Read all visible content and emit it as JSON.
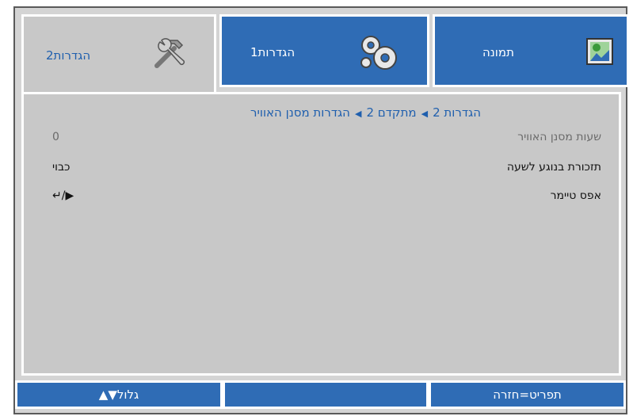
{
  "tabs": [
    {
      "label": "הגדרות2",
      "icon": "tools-icon",
      "active": true
    },
    {
      "label": "הגדרות1",
      "icon": "gears-icon",
      "active": false
    },
    {
      "label": "תמונה",
      "icon": "picture-icon",
      "active": false
    }
  ],
  "breadcrumb": {
    "part1": "הגדרות 2",
    "part2": "מתקדם 2",
    "part3": "הגדרות מסנן האוויר",
    "separator": "◀"
  },
  "settings": [
    {
      "label": "שעות מסנן האוויר",
      "value": "0",
      "enabled": false
    },
    {
      "label": "תזכורת בנוגע לשעה",
      "value": "כבוי",
      "enabled": true
    },
    {
      "label": "אפס טיימר",
      "value": "↵/▶",
      "enabled": true
    }
  ],
  "footer": {
    "scroll": "גלול▼▲",
    "middle": "",
    "menu": "תפריט=חזרה"
  },
  "colors": {
    "accent_blue": "#2f6cb5",
    "panel_gray": "#c8c8c8",
    "text_blue": "#1f5fae"
  }
}
